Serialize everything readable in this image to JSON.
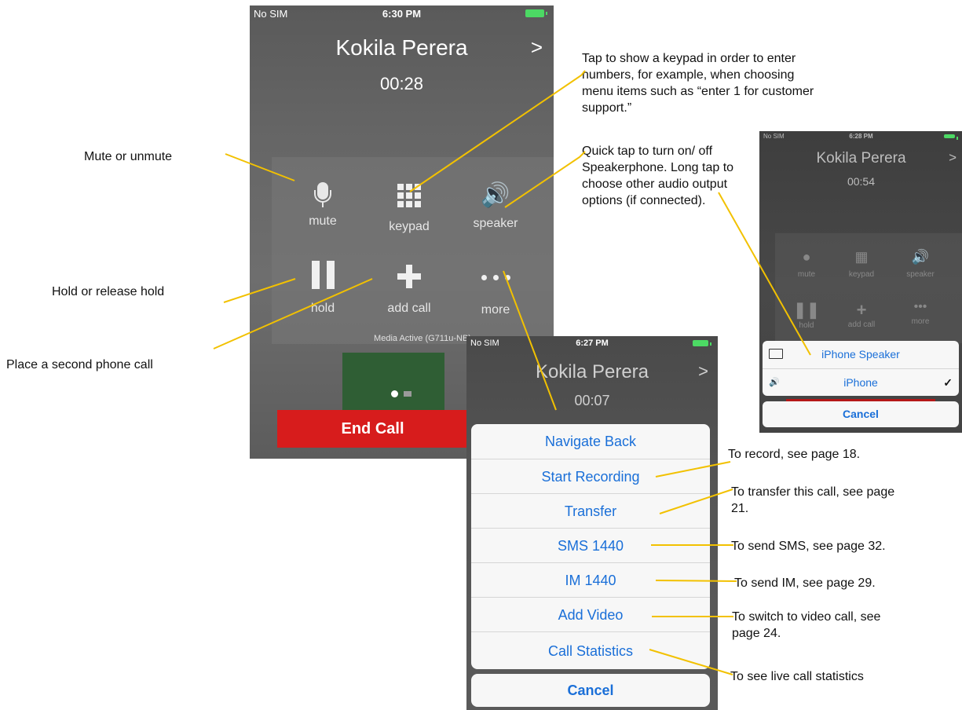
{
  "main_phone": {
    "status": {
      "carrier": "No SIM",
      "time": "6:30 PM"
    },
    "caller": "Kokila Perera",
    "duration": "00:28",
    "buttons": {
      "mute": "mute",
      "keypad": "keypad",
      "speaker": "speaker",
      "hold": "hold",
      "add_call": "add call",
      "more": "more"
    },
    "media_status": "Media Active (G711u-NB)",
    "end_call": "End Call"
  },
  "more_phone": {
    "status": {
      "carrier": "No SIM",
      "time": "6:27 PM"
    },
    "caller": "Kokila Perera",
    "duration": "00:07",
    "menu": [
      "Navigate Back",
      "Start Recording",
      "Transfer",
      "SMS 1440",
      "IM 1440",
      "Add Video",
      "Call Statistics"
    ],
    "cancel": "Cancel"
  },
  "audio_phone": {
    "status": {
      "carrier": "No SIM",
      "time": "6:28 PM"
    },
    "caller": "Kokila Perera",
    "duration": "00:54",
    "buttons": {
      "mute": "mute",
      "keypad": "keypad",
      "speaker": "speaker",
      "hold": "hold",
      "add_call": "add call",
      "more": "more"
    },
    "audio_options": [
      {
        "label": "iPhone Speaker",
        "icon": "monitor-icon",
        "selected": false
      },
      {
        "label": "iPhone",
        "icon": "speaker-icon",
        "selected": true
      }
    ],
    "selected_mark": "✓",
    "cancel": "Cancel"
  },
  "annotations": {
    "mute": "Mute or unmute",
    "hold": "Hold or release hold",
    "add_call": "Place a second phone call",
    "keypad": "Tap to show a keypad in order to enter numbers, for example, when choosing menu items such as “enter 1 for customer support.”",
    "speaker": "Quick tap to turn on/ off Speakerphone. Long tap to choose other audio output options (if connected).",
    "record": "To record, see page 18.",
    "transfer": "To transfer this call, see page 21.",
    "sms": "To send SMS, see page 32.",
    "im": "To send IM, see page 29.",
    "video": "To switch to video call, see page 24.",
    "stats": "To see live call statistics"
  },
  "colors": {
    "end_call": "#d71c1c",
    "link_blue": "#1a6fd8",
    "leader_line": "#f2c100"
  }
}
